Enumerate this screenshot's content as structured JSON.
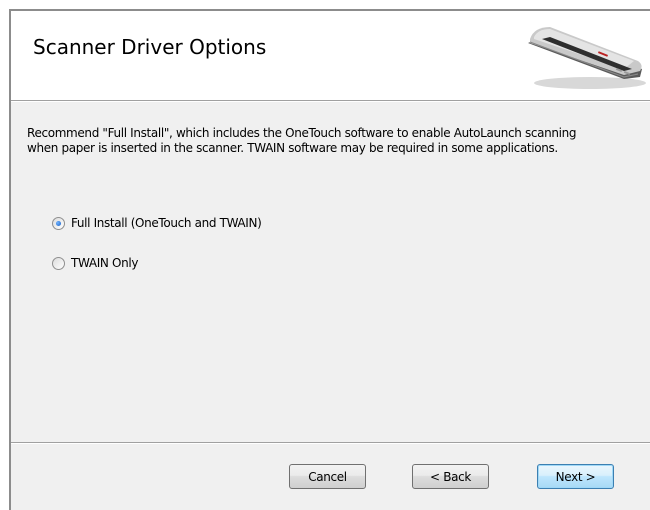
{
  "header": {
    "title": "Scanner Driver Options"
  },
  "body": {
    "description_line1": "Recommend \"Full Install\", which includes the OneTouch software to enable AutoLaunch scanning",
    "description_line2": "when paper is inserted in the scanner. TWAIN software may be required in some applications.",
    "options": [
      {
        "label": "Full Install (OneTouch and TWAIN)",
        "checked": true
      },
      {
        "label": "TWAIN Only",
        "checked": false
      }
    ]
  },
  "footer": {
    "cancel_label": "Cancel",
    "back_label": "< Back",
    "next_label": "Next >"
  }
}
